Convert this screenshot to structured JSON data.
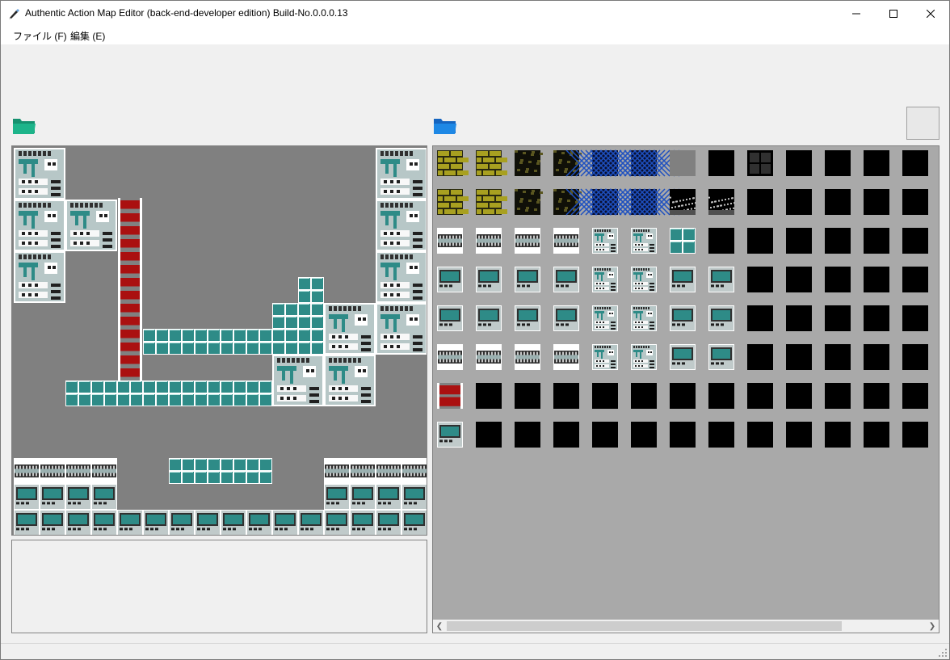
{
  "window": {
    "title": "Authentic Action Map Editor (back-end-developer edition) Build-No.0.0.0.13",
    "icons": {
      "app": "pen-icon",
      "minimize": "minimize-icon",
      "maximize": "maximize-icon",
      "close": "close-icon"
    }
  },
  "menu": {
    "file": "ファイル (F)",
    "edit": "編集 (E)"
  },
  "toolbar": {
    "open_map_icon": "folder-open-icon",
    "open_tileset_icon": "folder-open-icon"
  },
  "colors": {
    "map_background": "#808080",
    "tileset_background": "#a9a9a9",
    "tile_teal": "#2e8b87",
    "ladder_red": "#aa1010",
    "brick_olive": "#a8a020",
    "mesh_blue": "#1e50c0",
    "folder_green": "#1db48a",
    "folder_blue": "#1e88e5"
  }
}
